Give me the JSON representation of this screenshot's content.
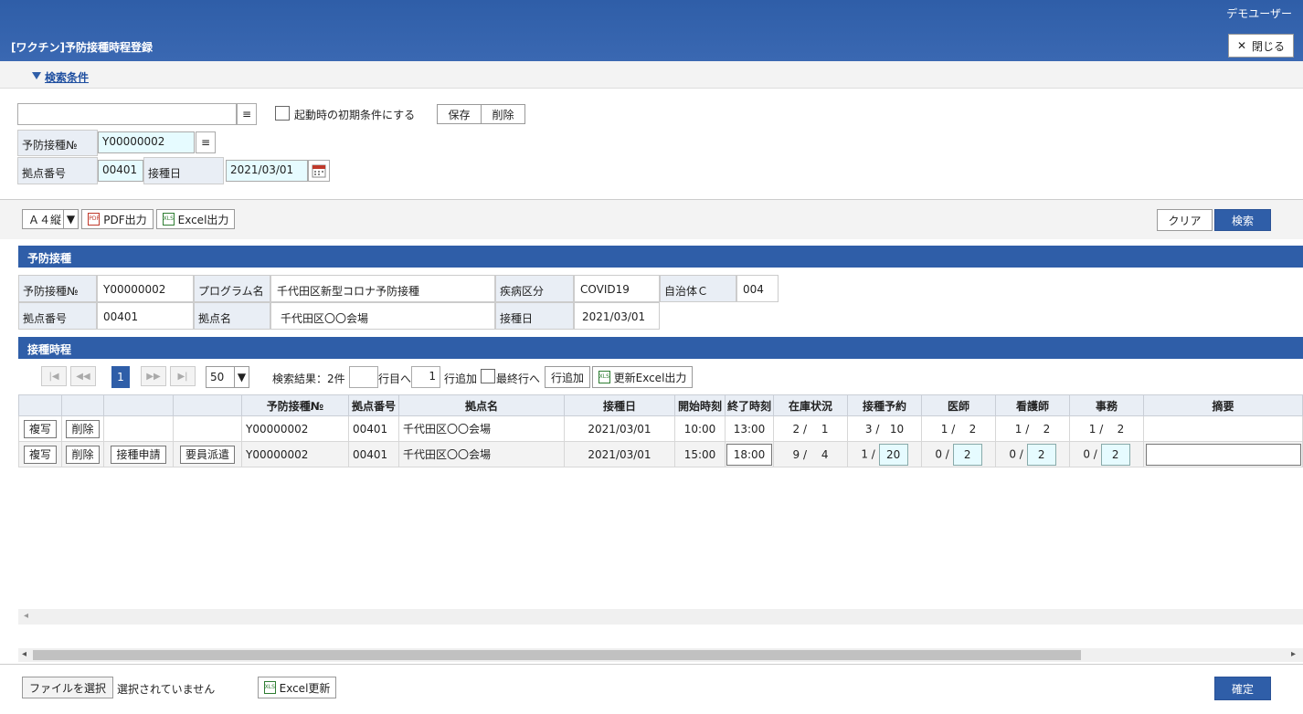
{
  "header": {
    "user": "デモユーザー",
    "title": "[ワクチン]予防接種時程登録",
    "close_label": "閉じる"
  },
  "cond": {
    "link": "検索条件",
    "checkbox_label": "起動時の初期条件にする",
    "save": "保存",
    "delete": "削除"
  },
  "search": {
    "no_label": "予防接種№",
    "no_value": "Y00000002",
    "site_label": "拠点番号",
    "site_value": "00401",
    "date_label": "接種日",
    "date_value": "2021/03/01"
  },
  "toolbar": {
    "paper": "Ａ４縦",
    "pdf": "PDF出力",
    "excel": "Excel出力",
    "clear": "クリア",
    "search": "検索"
  },
  "section1": {
    "title": "予防接種",
    "no_label": "予防接種№",
    "no_value": "Y00000002",
    "prog_label": "プログラム名",
    "prog_value": "千代田区新型コロナ予防接種",
    "disease_label": "疾病区分",
    "disease_value": "COVID19",
    "muni_label": "自治体Ｃ",
    "muni_value": "004",
    "site_label": "拠点番号",
    "site_value": "00401",
    "sitename_label": "拠点名",
    "sitename_value": "千代田区〇〇会場",
    "date_label": "接種日",
    "date_value": "2021/03/01"
  },
  "section2": {
    "title": "接種時程",
    "page": "1",
    "per_page": "50",
    "result": "検索結果：2件",
    "goto_suffix": "行目へ",
    "add_count": "1",
    "add_suffix": "行追加",
    "last_row": "最終行へ",
    "add_row": "行追加",
    "update_excel": "更新Excel出力"
  },
  "table": {
    "headers": [
      "",
      "",
      "",
      "",
      "予防接種№",
      "拠点番号",
      "拠点名",
      "接種日",
      "開始時刻",
      "終了時刻",
      "在庫状況",
      "接種予約",
      "医師",
      "看護師",
      "事務",
      "摘要"
    ],
    "rows": [
      {
        "copy": "複写",
        "del": "削除",
        "no": "Y00000002",
        "site": "00401",
        "name": "千代田区〇〇会場",
        "date": "2021/03/01",
        "start": "10:00",
        "end": "13:00",
        "stock": "2 /　 1",
        "resv_a": "3 /",
        "resv_b": "10",
        "doc_a": "1 /",
        "doc_b": "2",
        "nurse_a": "1 /",
        "nurse_b": "2",
        "office_a": "1 /",
        "office_b": "2"
      },
      {
        "copy": "複写",
        "del": "削除",
        "apply": "接種申請",
        "dispatch": "要員派遣",
        "no": "Y00000002",
        "site": "00401",
        "name": "千代田区〇〇会場",
        "date": "2021/03/01",
        "start": "15:00",
        "end": "18:00",
        "stock": "9 /　 4",
        "resv_a": "1 /",
        "resv_b": "20",
        "doc_a": "0 /",
        "doc_b": "2",
        "nurse_a": "0 /",
        "nurse_b": "2",
        "office_a": "0 /",
        "office_b": "2"
      }
    ]
  },
  "footer": {
    "file_btn": "ファイルを選択",
    "file_status": "選択されていません",
    "excel_update": "Excel更新",
    "confirm": "確定"
  }
}
